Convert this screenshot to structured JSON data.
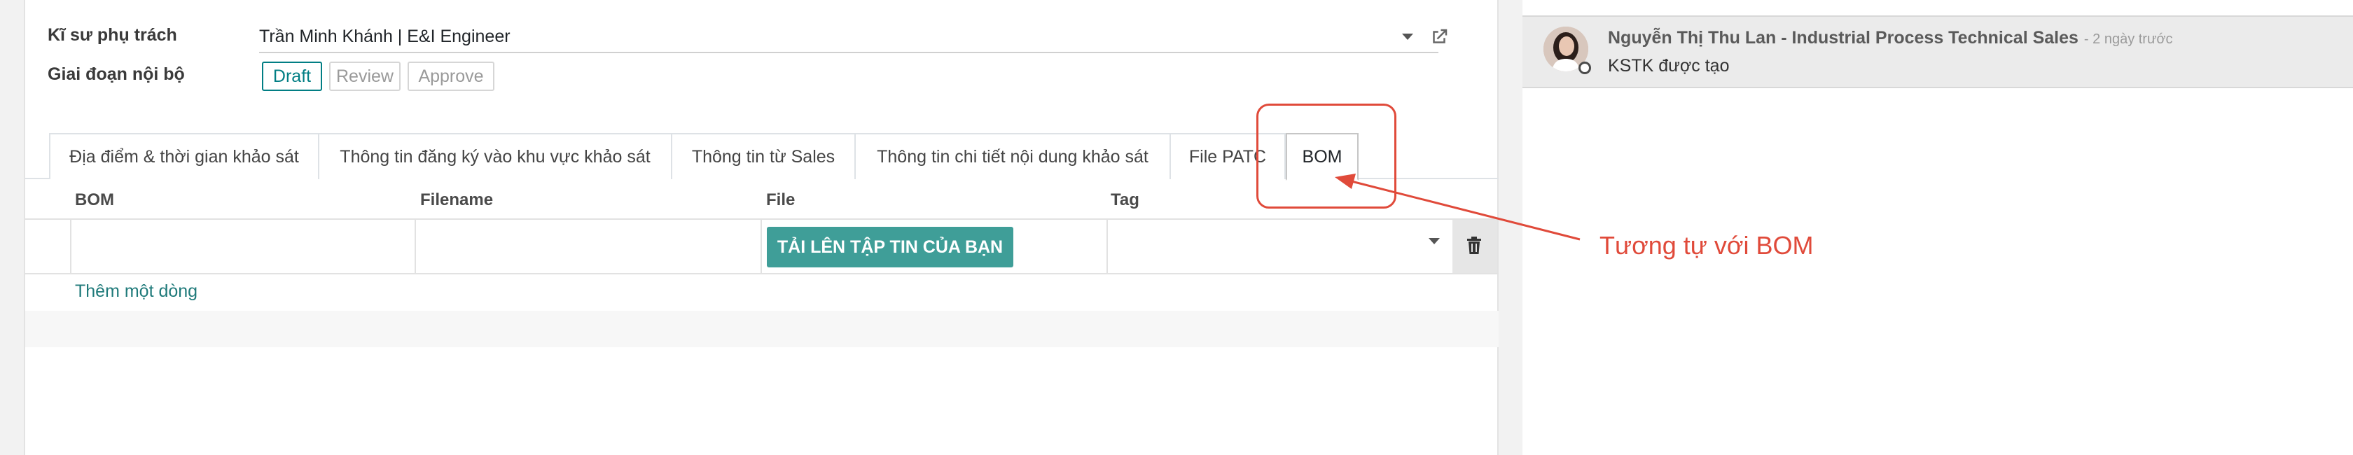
{
  "form": {
    "engineer_label": "Kĩ sư phụ trách",
    "engineer_value": "Trần Minh Khánh | E&I Engineer",
    "stage_label": "Giai đoạn nội bộ",
    "stages": [
      "Draft",
      "Review",
      "Approve"
    ],
    "active_stage": "Draft"
  },
  "tabs": [
    "Địa điểm & thời gian khảo sát",
    "Thông tin đăng ký vào khu vực khảo sát",
    "Thông tin từ Sales",
    "Thông tin chi tiết nội dung khảo sát",
    "File PATC",
    "BOM"
  ],
  "active_tab": "BOM",
  "table": {
    "columns": [
      "BOM",
      "Filename",
      "File",
      "Tag"
    ],
    "upload_label": "TẢI LÊN TẬP TIN CỦA BẠN",
    "add_line_label": "Thêm một dòng"
  },
  "chatter": {
    "author": "Nguyễn Thị Thu Lan - Industrial Process Technical Sales",
    "time": "- 2 ngày trước",
    "body": "KSTK được tạo"
  },
  "annotation": {
    "text": "Tương tự với BOM",
    "color": "#e04a3a"
  },
  "colors": {
    "accent": "#017e84",
    "upload_button": "#3f9e98",
    "link": "#1f7a7a"
  },
  "icons": [
    "caret-down-icon",
    "external-link-icon",
    "trash-icon",
    "avatar",
    "status-dot"
  ]
}
